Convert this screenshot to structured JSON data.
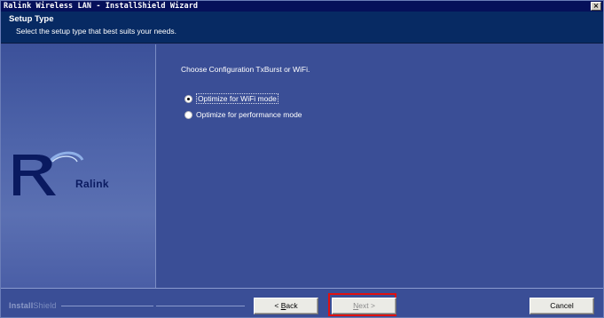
{
  "window": {
    "title": "Ralink Wireless LAN - InstallShield Wizard",
    "close_glyph": "×"
  },
  "header": {
    "title": "Setup Type",
    "subtitle": "Select the setup type that best suits your needs."
  },
  "logo": {
    "word": "Ralink"
  },
  "content": {
    "prompt": "Choose Configuration TxBurst or WiFi.",
    "options": [
      {
        "label": "Optimize for WiFi mode",
        "selected": true
      },
      {
        "label": "Optimize for performance mode",
        "selected": false
      }
    ]
  },
  "footer": {
    "brand_bold": "Install",
    "brand_light": "Shield",
    "back": {
      "mnemonic": "B",
      "rest": "ack",
      "prefix": "< "
    },
    "next": {
      "mnemonic": "N",
      "rest": "ext",
      "suffix": " >",
      "enabled": false
    },
    "cancel": "Cancel"
  },
  "colors": {
    "title_bar": "#05105a",
    "header": "#072a63",
    "body": "#3a4e96",
    "highlight": "#e01010"
  },
  "icons": {
    "close": "close-icon",
    "logo": "ralink-logo-icon",
    "radio_selected": "radio-selected-icon",
    "radio_unselected": "radio-unselected-icon"
  }
}
